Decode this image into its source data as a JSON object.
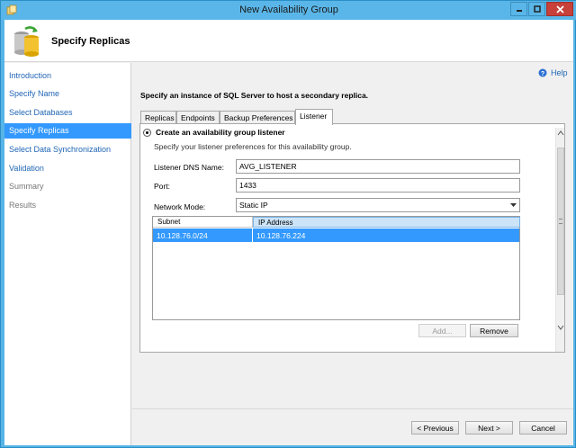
{
  "window": {
    "title": "New Availability Group"
  },
  "header": {
    "title": "Specify Replicas"
  },
  "nav": {
    "items": [
      {
        "label": "Introduction",
        "state": "link"
      },
      {
        "label": "Specify Name",
        "state": "link"
      },
      {
        "label": "Select Databases",
        "state": "link"
      },
      {
        "label": "Specify Replicas",
        "state": "active"
      },
      {
        "label": "Select Data Synchronization",
        "state": "link"
      },
      {
        "label": "Validation",
        "state": "link"
      },
      {
        "label": "Summary",
        "state": "disabled"
      },
      {
        "label": "Results",
        "state": "disabled"
      }
    ]
  },
  "help": {
    "label": "Help"
  },
  "main": {
    "instruction": "Specify an instance of SQL Server to host a secondary replica.",
    "tabs": [
      {
        "label": "Replicas"
      },
      {
        "label": "Endpoints"
      },
      {
        "label": "Backup Preferences"
      },
      {
        "label": "Listener"
      }
    ],
    "listener": {
      "create_option": "Create an availability group listener",
      "description": "Specify your listener preferences for this availability group.",
      "dns_label": "Listener DNS Name:",
      "dns_value": "AVG_LISTENER",
      "port_label": "Port:",
      "port_value": "1433",
      "mode_label": "Network Mode:",
      "mode_value": "Static IP",
      "grid_headers": [
        "Subnet",
        "IP Address"
      ],
      "grid_rows": [
        {
          "subnet": "10.128.76.0/24",
          "ip": "10.128.76.224"
        }
      ],
      "add_label": "Add...",
      "remove_label": "Remove"
    }
  },
  "footer": {
    "previous_label": "< Previous",
    "next_label": "Next >",
    "cancel_label": "Cancel"
  },
  "colors": {
    "title_bar": "#5ab6e8",
    "nav_active": "#3399ff",
    "link": "#2166b5"
  }
}
